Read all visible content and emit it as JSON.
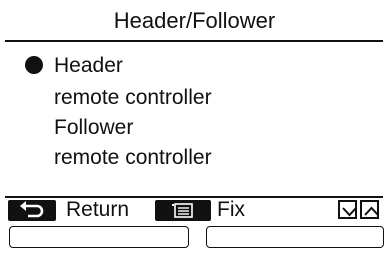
{
  "header": {
    "title": "Header/Follower"
  },
  "options": [
    {
      "line1": "Header",
      "line2": "remote controller",
      "selected": true
    },
    {
      "line1": "Follower",
      "line2": "remote controller",
      "selected": false
    }
  ],
  "function_bar": {
    "return_label": "Return",
    "return_icon": "return-arrow-icon",
    "fix_label": "Fix",
    "fix_icon": "menu-icon",
    "nav_icons": [
      "chevron-down-icon",
      "chevron-up-icon"
    ]
  },
  "soft_boxes": [
    {
      "label": ""
    },
    {
      "label": ""
    }
  ]
}
